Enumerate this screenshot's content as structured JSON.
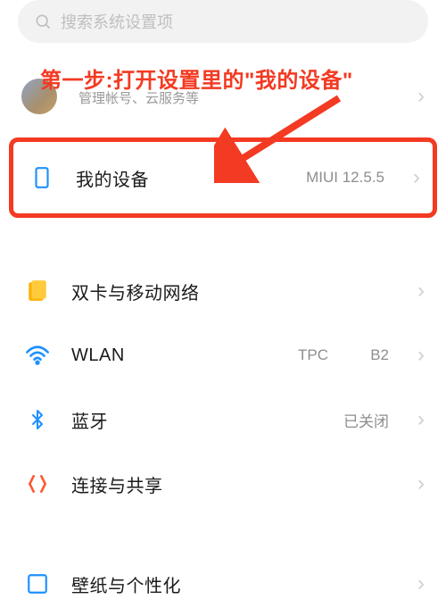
{
  "search": {
    "placeholder": "搜索系统设置项"
  },
  "account": {
    "title": "",
    "subtitle": "管理帐号、云服务等"
  },
  "callout": "第一步:打开设置里的\"我的设备\"",
  "items": {
    "my_device": {
      "title": "我的设备",
      "value": "MIUI 12.5.5"
    },
    "sim": {
      "title": "双卡与移动网络",
      "value": ""
    },
    "wlan": {
      "title": "WLAN",
      "value": "TPC          B2"
    },
    "bluetooth": {
      "title": "蓝牙",
      "value": "已关闭"
    },
    "share": {
      "title": "连接与共享",
      "value": ""
    },
    "wallpaper": {
      "title": "壁纸与个性化",
      "value": ""
    }
  },
  "colors": {
    "highlight": "#f33a22",
    "sim_icon": "#ffb000",
    "wlan_icon": "#1e90ff",
    "bt_icon": "#1e90ff",
    "share_icon": "#ff5730",
    "device_icon": "#1e90ff"
  }
}
